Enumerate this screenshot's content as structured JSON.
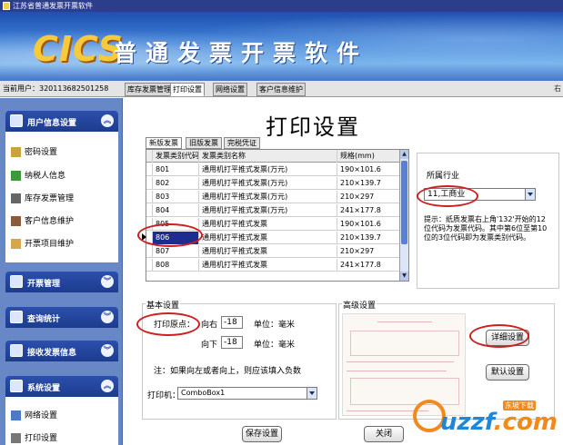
{
  "window": {
    "title": "江苏省普通发票开票软件"
  },
  "banner": {
    "logo": "CICS",
    "app_title": "普通发票开票软件"
  },
  "topbar": {
    "current_user": "当前用户：320113682501258",
    "tabs": [
      "库存发票管理",
      "打印设置",
      "网络设置",
      "客户信息维护"
    ],
    "active_tab": "打印设置",
    "edge_char": "右"
  },
  "sidebar": {
    "groups": [
      {
        "label": "用户信息设置",
        "items": [
          "密码设置",
          "纳税人信息",
          "库存发票管理",
          "客户信息维护",
          "开票项目维护"
        ]
      },
      {
        "label": "开票管理",
        "items": []
      },
      {
        "label": "查询统计",
        "items": []
      },
      {
        "label": "接收发票信息",
        "items": []
      },
      {
        "label": "系统设置",
        "items": [
          "网络设置",
          "打印设置"
        ]
      }
    ]
  },
  "page": {
    "title": "打印设置",
    "subtabs": [
      "新版发票",
      "旧版发票",
      "完税凭证"
    ],
    "active_subtab": "新版发票"
  },
  "grid": {
    "headers": [
      "发票类别代码",
      "发票类别名称",
      "规格(mm)"
    ],
    "rows": [
      [
        "801",
        "通用机打平推式发票(万元)",
        "190×101.6"
      ],
      [
        "802",
        "通用机打平推式发票(万元)",
        "210×139.7"
      ],
      [
        "803",
        "通用机打平推式发票(万元)",
        "210×297"
      ],
      [
        "804",
        "通用机打平推式发票(万元)",
        "241×177.8"
      ],
      [
        "805",
        "通用机打平推式发票",
        "190×101.6"
      ],
      [
        "806",
        "通用机打平推式发票",
        "210×139.7"
      ],
      [
        "807",
        "通用机打平推式发票",
        "210×297"
      ],
      [
        "808",
        "通用机打平推式发票",
        "241×177.8"
      ]
    ],
    "selected_row": 5
  },
  "industry": {
    "label": "所属行业",
    "selected": "11,工商业",
    "hint": "提示：纸质发票右上角'132'开始的12位代码为发票代码。其中第6位至第10位的3位代码即为发票类别代码。"
  },
  "basic": {
    "title": "基本设置",
    "origin_label": "打印原点：",
    "right_label": "向右",
    "right_value": "-18",
    "down_label": "向下",
    "down_value": "-18",
    "unit_label": "单位：毫米",
    "note": "注：如果向左或者向上，则应该填入负数",
    "printer_label": "打印机：",
    "printer_value": "ComboBox1"
  },
  "advanced": {
    "title": "高级设置",
    "detail_button": "详细设置",
    "default_button": "默认设置"
  },
  "footer": {
    "save_button": "保存设置",
    "close_button": "关闭"
  },
  "watermark": {
    "brand": "uzzf",
    "domain_suffix": ".com",
    "tag": "东坡下载"
  },
  "colors": {
    "banner": "#3f82d8",
    "sidebar": "#6887c6",
    "selected_row": "#1c2c8f",
    "annotation": "#cc1f1f"
  }
}
